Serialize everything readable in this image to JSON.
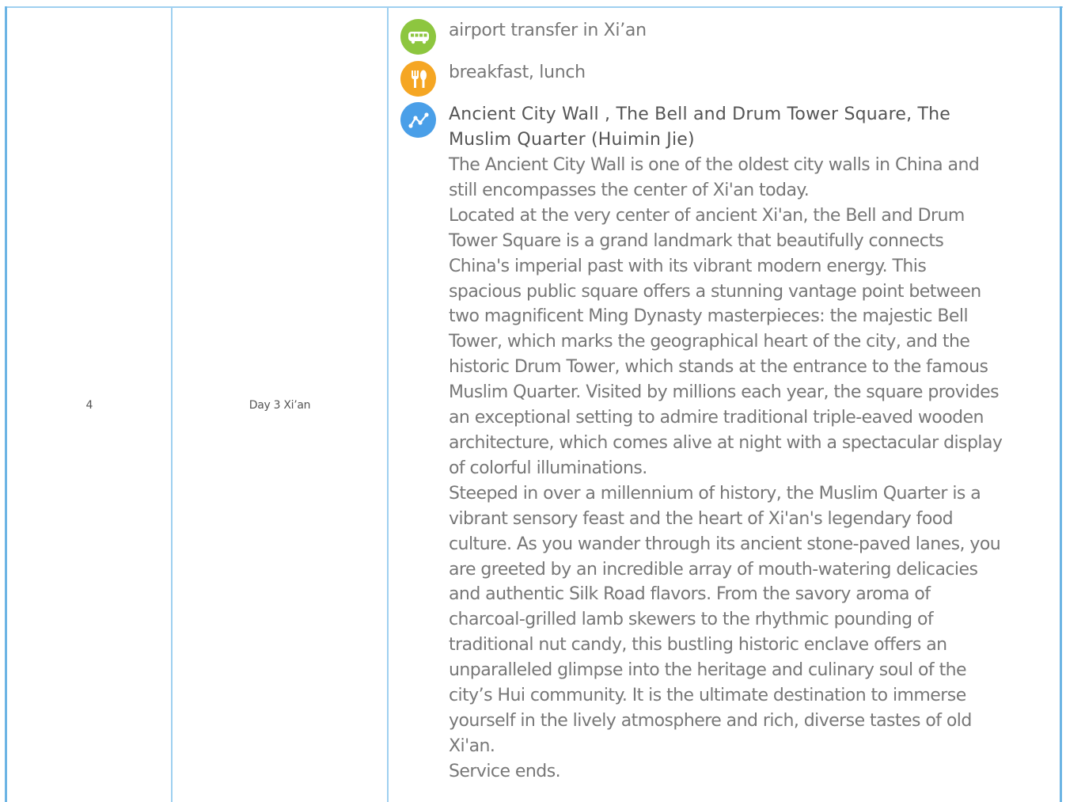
{
  "row": {
    "number": "4",
    "day": "Day 3 Xi’an"
  },
  "items": [
    {
      "icon": "bus-icon",
      "color": "#8dc63f",
      "text": "airport transfer in Xi’an"
    },
    {
      "icon": "fork-knife-icon",
      "color": "#f5a623",
      "text": "breakfast, lunch"
    },
    {
      "icon": "route-icon",
      "color": "#4a9fe8",
      "text": ""
    }
  ],
  "attractions": {
    "title": "Ancient City Wall , The Bell and Drum Tower Square, The Muslim Quarter (Huimin Jie)",
    "paragraphs": [
      "The Ancient City Wall is one of the oldest city walls in China and still encompasses the center of Xi'an today.",
      "Located at the very center of ancient Xi'an, the Bell and Drum Tower Square is a grand landmark that beautifully connects China's imperial past with its vibrant modern energy. This spacious public square offers a stunning vantage point between two magnificent Ming Dynasty masterpieces: the majestic Bell Tower, which marks the geographical heart of the city, and the historic Drum Tower, which stands at the entrance to the famous Muslim Quarter. Visited by millions each year, the square provides an exceptional setting to admire traditional triple-eaved wooden architecture, which comes alive at night with a spectacular display of colorful illuminations.",
      "Steeped in over a millennium of history, the Muslim Quarter is a vibrant sensory feast and the heart of Xi'an's legendary food culture. As you wander through its ancient stone-paved lanes, you are greeted by an incredible array of mouth-watering delicacies and authentic Silk Road flavors. From the savory aroma of charcoal-grilled lamb skewers to the rhythmic pounding of traditional nut candy, this bustling historic enclave offers an unparalleled glimpse into the heritage and culinary soul of the city’s Hui community. It is the ultimate destination to immerse yourself in the lively atmosphere and rich, diverse tastes of old Xi'an.",
      "Service ends."
    ]
  },
  "colors": {
    "border": "#9fd0f0",
    "border_strong": "#6cb4e4"
  }
}
